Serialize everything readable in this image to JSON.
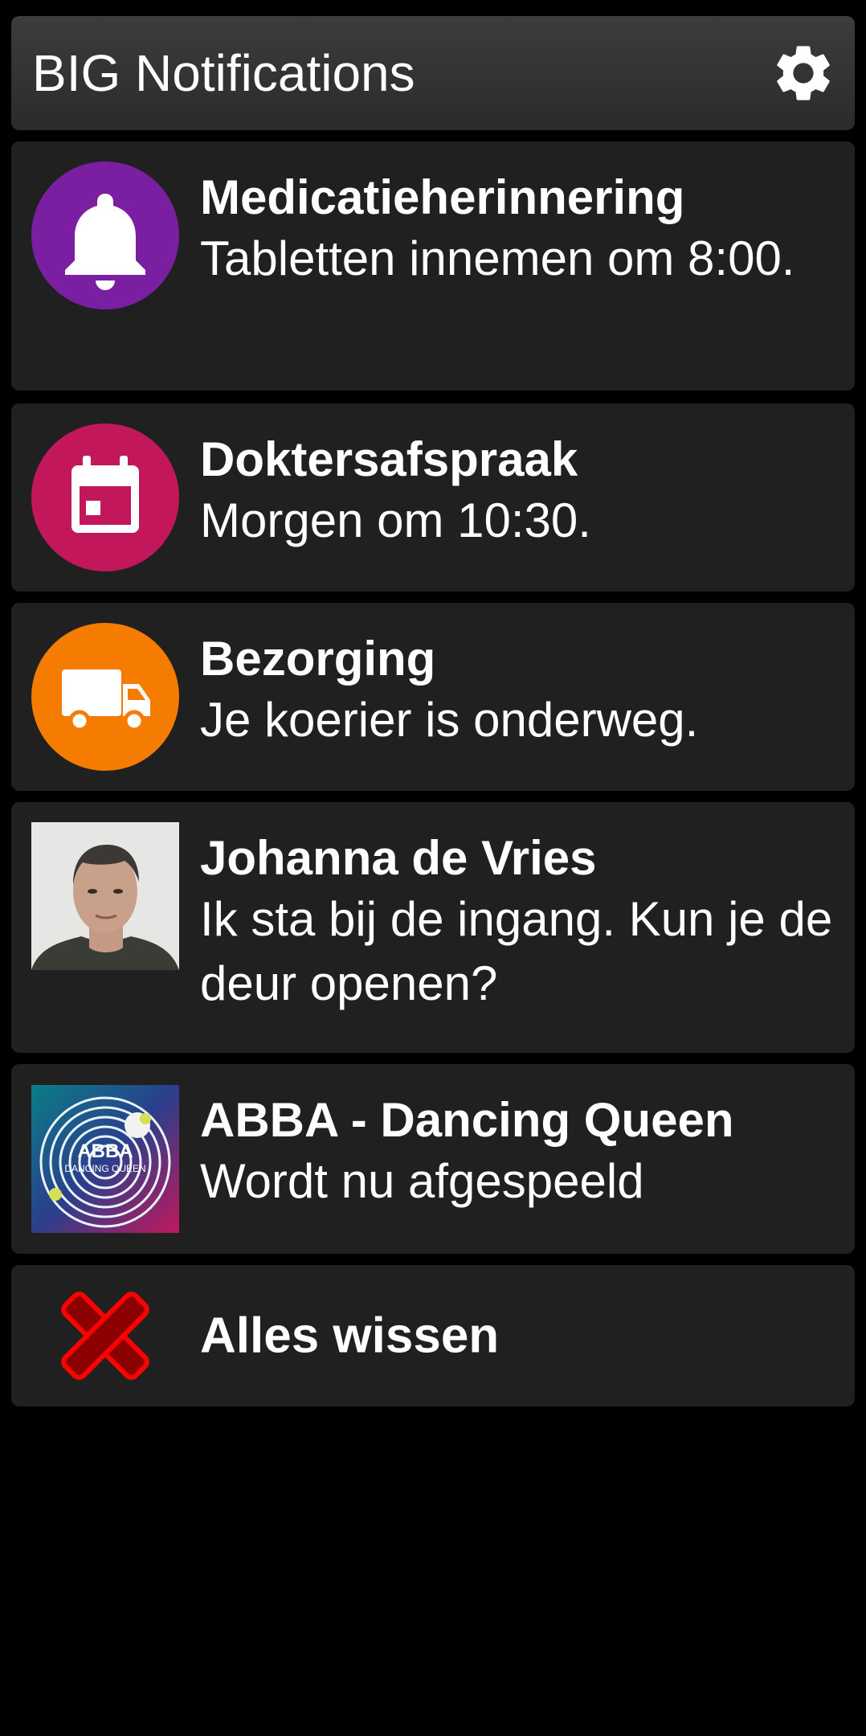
{
  "app": {
    "title": "BIG Notifications",
    "settings_icon": "gear-icon"
  },
  "notifications": [
    {
      "title": "Medicatieherinnering",
      "body": "Tabletten innemen om 8:00.",
      "icon": "bell-icon",
      "icon_color": "#7b1fa2"
    },
    {
      "title": "Doktersafspraak",
      "body": "Morgen om 10:30.",
      "icon": "calendar-icon",
      "icon_color": "#c2185b"
    },
    {
      "title": "Bezorging",
      "body": "Je koerier is onderweg.",
      "icon": "truck-icon",
      "icon_color": "#f57c00"
    },
    {
      "title": "Johanna de Vries",
      "body": "Ik sta bij de ingang. Kun je de deur openen?",
      "icon": "contact-avatar"
    },
    {
      "title": "ABBA - Dancing Queen",
      "body": "Wordt nu afgespeeld",
      "icon": "album-art",
      "art_text": "ABBA",
      "art_subtext": "DANCING QUEEN"
    }
  ],
  "clear_all": {
    "label": "Alles wissen",
    "icon": "close-icon",
    "icon_color": "#cc0000"
  },
  "colors": {
    "background": "#000000",
    "card": "#202020",
    "header": "#333333",
    "text": "#ffffff"
  }
}
